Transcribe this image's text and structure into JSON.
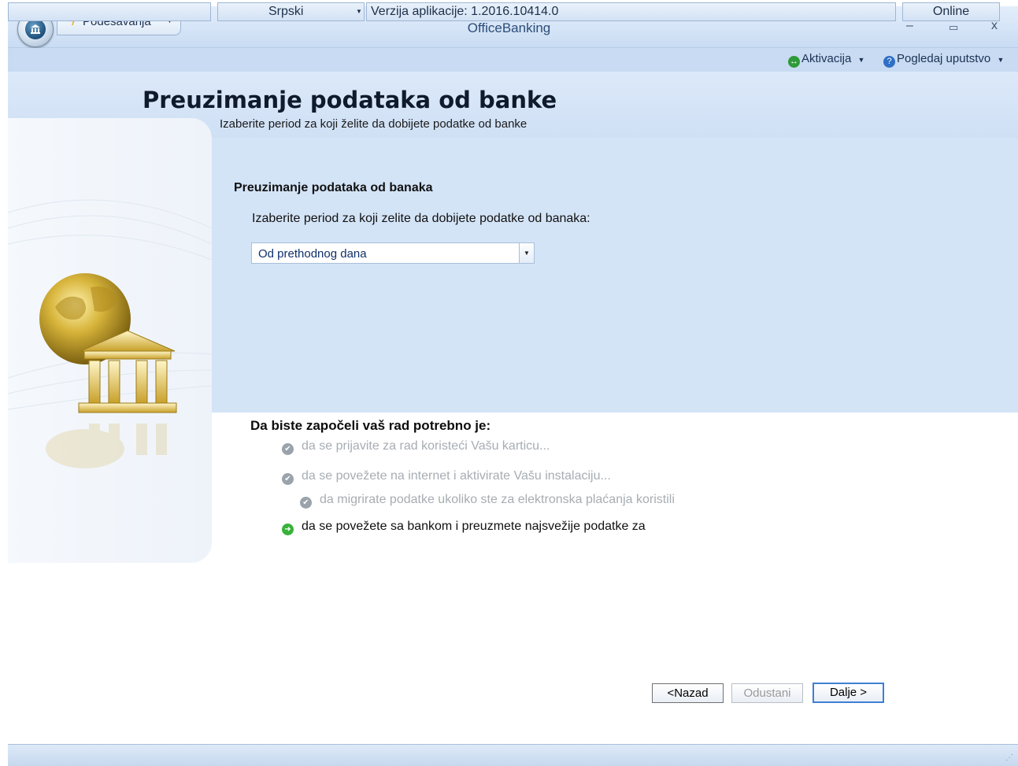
{
  "window": {
    "title": "OfficeBanking",
    "menu_label": "Podešavanja",
    "controls": {
      "minimize": "–",
      "maximize": "▭",
      "close": "x"
    }
  },
  "helpbar": {
    "activation": "Aktivacija",
    "manual": "Pogledaj uputstvo"
  },
  "header": {
    "title": "Preuzimanje podataka od banke",
    "subtitle": "Izaberite period za koji želite da dobijete podatke od banke"
  },
  "content": {
    "section_title": "Preuzimanje podataka od banaka",
    "period_label": "Izaberite period za koji zelite da dobijete podatke od banaka:",
    "period_select": {
      "value": "Od prethodnog dana"
    }
  },
  "steps": {
    "title": "Da biste započeli vaš rad potrebno je:",
    "items": [
      {
        "label": "da se prijavite za rad koristeći Vašu karticu...",
        "state": "done"
      },
      {
        "label": "da se povežete na internet i aktivirate Vašu instalaciju...",
        "state": "done"
      },
      {
        "label": "da migrirate podatke ukoliko ste za elektronska plaćanja koristili",
        "state": "done"
      },
      {
        "label": "da se povežete sa bankom i preuzmete najsvežije podatke za",
        "state": "current"
      }
    ]
  },
  "buttons": {
    "back": "<Nazad",
    "cancel": "Odustani",
    "next": "Dalje >"
  },
  "statusbar": {
    "language": "Srpski",
    "version": "Verzija aplikacije: 1.2016.10414.0",
    "status": "Online"
  },
  "colors": {
    "accent": "#3f7fd3",
    "panel": "#d4e4f7",
    "header": "#dce9f9",
    "done_text": "#a7adb3",
    "current_icon": "#38b23a"
  }
}
